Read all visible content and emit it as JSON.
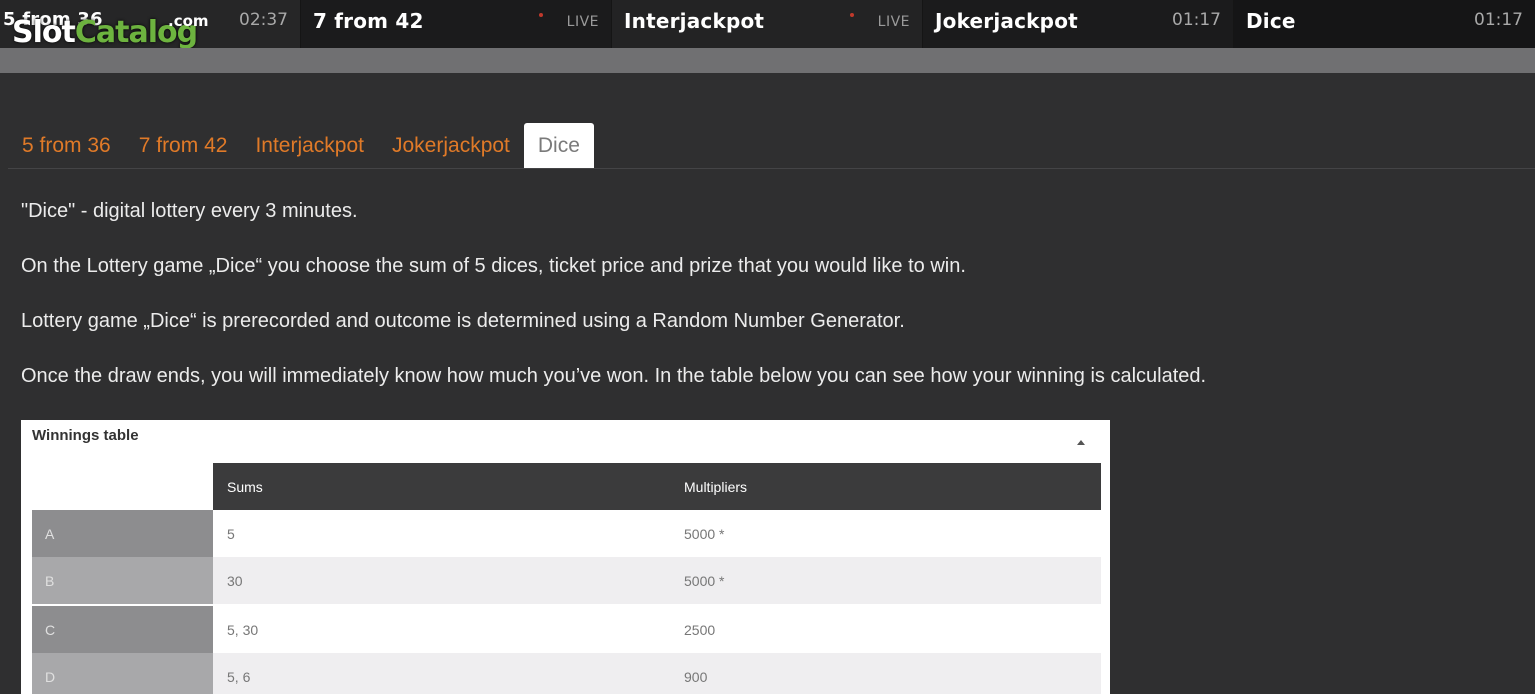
{
  "ticker": [
    {
      "name": "5 from 36",
      "time": "02:37",
      "live": ""
    },
    {
      "name": "7 from 42",
      "time": "",
      "live": "LIVE"
    },
    {
      "name": "Interjackpot",
      "time": "",
      "live": "LIVE"
    },
    {
      "name": "Jokerjackpot",
      "time": "01:17",
      "live": ""
    },
    {
      "name": "Dice",
      "time": "01:17",
      "live": ""
    }
  ],
  "logo": {
    "slot": "Slot",
    "catalog": "Catalog",
    "com": ".com"
  },
  "tabs": [
    {
      "label": "5 from 36",
      "active": false
    },
    {
      "label": "7 from 42",
      "active": false
    },
    {
      "label": "Interjackpot",
      "active": false
    },
    {
      "label": "Jokerjackpot",
      "active": false
    },
    {
      "label": "Dice",
      "active": true
    }
  ],
  "content": {
    "p1": "\"Dice\" - digital lottery every 3 minutes.",
    "p2": "On the Lottery game „Dice“ you choose the sum of 5 dices, ticket price and prize that you would like to win.",
    "p3": "Lottery game „Dice“ is prerecorded and outcome is determined using a Random Number Generator.",
    "p4": "Once the draw ends, you will immediately know how much you’ve won. In the table below you can see how your winning is calculated."
  },
  "winnings": {
    "title": "Winnings table",
    "headers": {
      "sums": "Sums",
      "multipliers": "Multipliers"
    },
    "rows": [
      {
        "letter": "A",
        "sums": "5",
        "multiplier": "5000 *"
      },
      {
        "letter": "B",
        "sums": "30",
        "multiplier": "5000 *"
      },
      {
        "letter": "C",
        "sums": "5, 30",
        "multiplier": "2500"
      },
      {
        "letter": "D",
        "sums": "5, 6",
        "multiplier": "900"
      }
    ]
  },
  "colors": {
    "accent": "#e07a28",
    "logo_green": "#6db33f",
    "live_dot": "#c0392b"
  }
}
